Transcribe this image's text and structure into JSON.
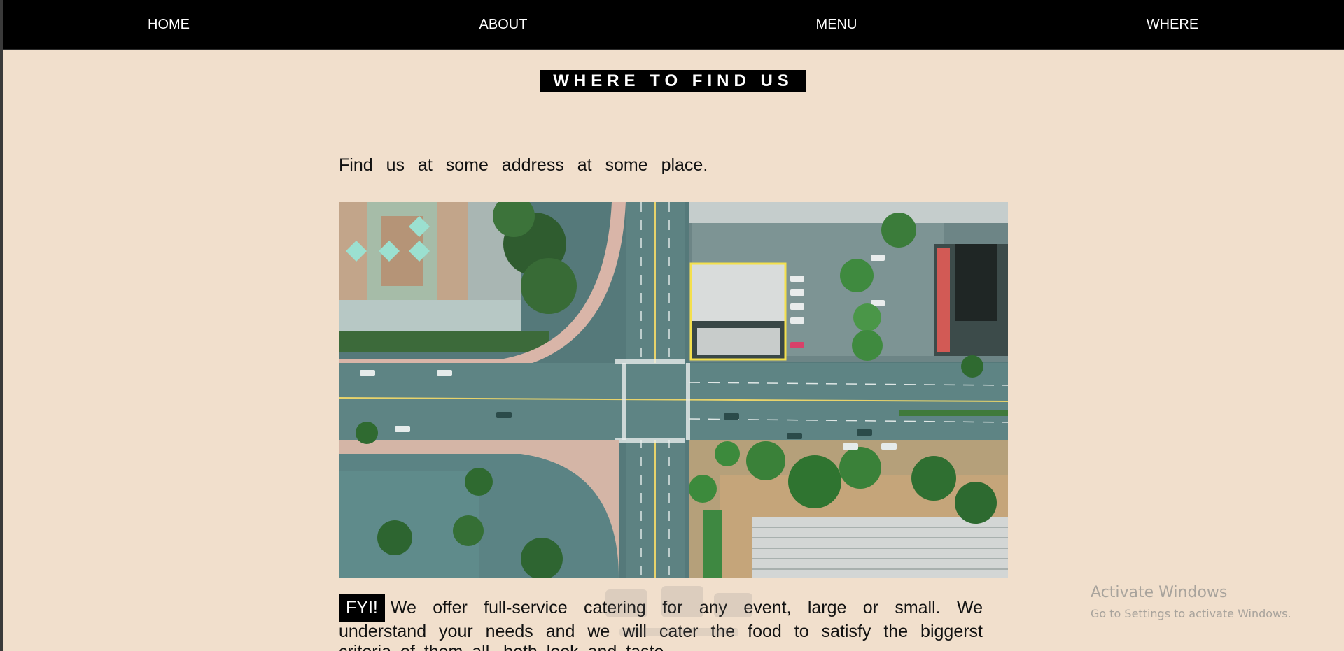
{
  "nav": {
    "home": "HOME",
    "about": "ABOUT",
    "menu": "MENU",
    "where": "WHERE"
  },
  "section": {
    "title": "WHERE TO FIND US",
    "intro": "Find us at some address at some place."
  },
  "fyi": {
    "badge": "FYI!",
    "text": "We offer full-service catering for any event, large or small. We understand your needs and we will cater the food to satisfy the biggerst criteria of them all, both look and taste."
  },
  "windows_notice": {
    "title": "Activate Windows",
    "subtitle": "Go to Settings to activate Windows."
  },
  "colors": {
    "page_background": "#f1dfcc",
    "navbar": "#000000",
    "highlight_box": "#f4e04d"
  }
}
